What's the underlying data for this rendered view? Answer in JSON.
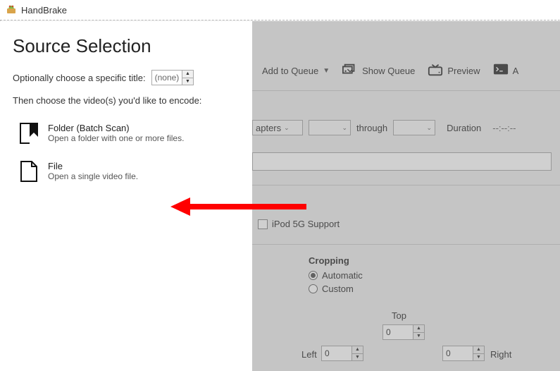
{
  "titlebar": {
    "app_name": "HandBrake"
  },
  "panel": {
    "heading": "Source Selection",
    "title_label": "Optionally choose a specific title:",
    "title_value": "(none)",
    "instruction": "Then choose the video(s) you'd like to encode:",
    "folder": {
      "title": "Folder (Batch Scan)",
      "sub": "Open a folder with one or more files."
    },
    "file": {
      "title": "File",
      "sub": "Open a single video file."
    }
  },
  "toolbar": {
    "add_queue": "Add to Queue",
    "show_queue": "Show Queue",
    "preview": "Preview",
    "activity_initial": "A"
  },
  "chapters": {
    "label": "apters",
    "through": "through",
    "duration_label": "Duration",
    "duration_value": "--:--:--"
  },
  "ipod": {
    "label": "iPod 5G Support"
  },
  "cropping": {
    "title": "Cropping",
    "auto": "Automatic",
    "custom": "Custom",
    "top_label": "Top",
    "left_label": "Left",
    "right_label": "Right",
    "top_val": "0",
    "left_val": "0",
    "right_val": "0"
  }
}
